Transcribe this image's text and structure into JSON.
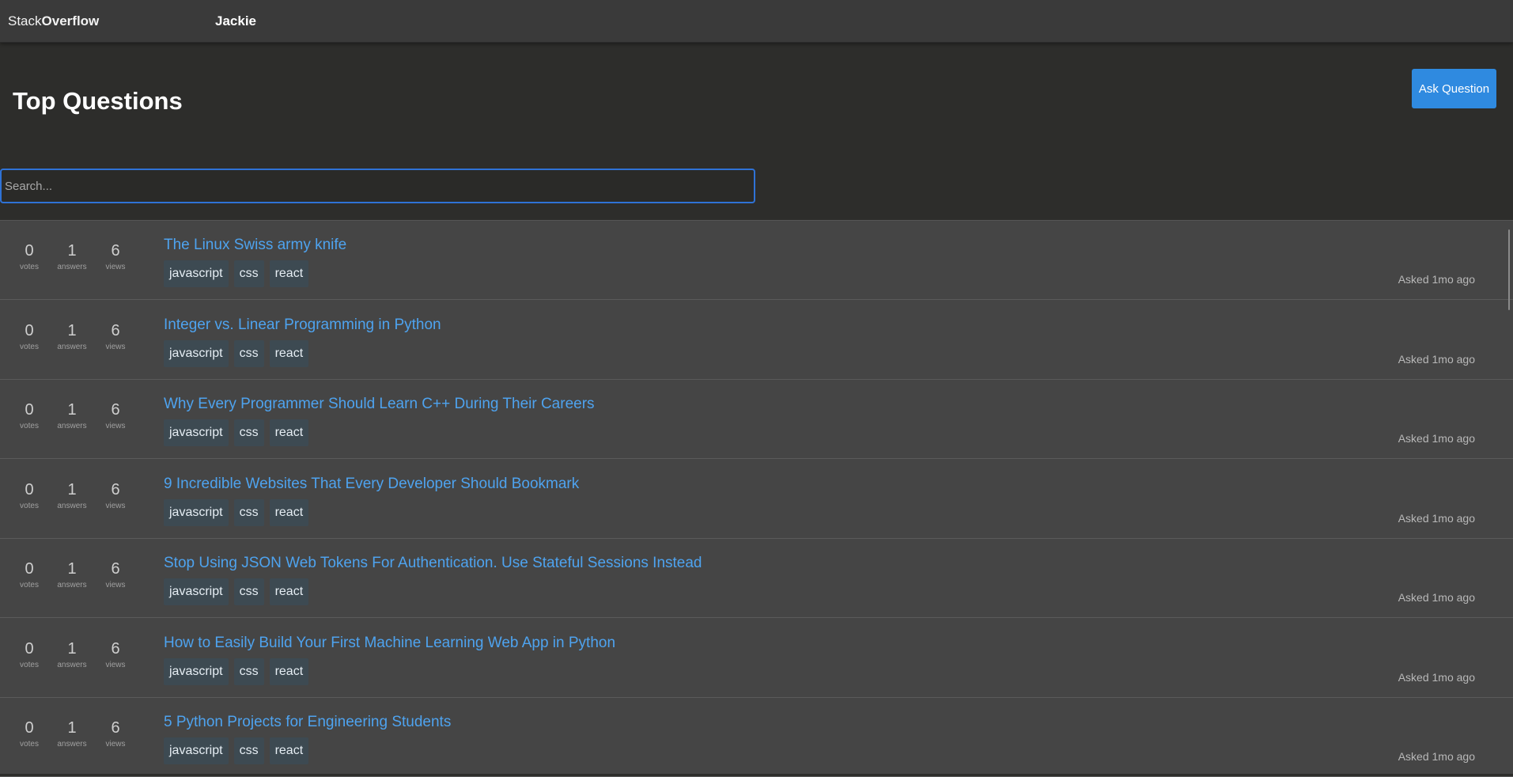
{
  "header": {
    "logo_prefix": "Stack",
    "logo_suffix": "Overflow",
    "user_name": "Jackie"
  },
  "main": {
    "title": "Top Questions",
    "ask_button_label": "Ask Question",
    "search_placeholder": "Search...",
    "stat_labels": {
      "votes": "votes",
      "answers": "answers",
      "views": "views"
    }
  },
  "questions": [
    {
      "title": "The Linux Swiss army knife",
      "votes": "0",
      "answers": "1",
      "views": "6",
      "tags": [
        "javascript",
        "css",
        "react"
      ],
      "asked": "Asked 1mo ago"
    },
    {
      "title": "Integer vs. Linear Programming in Python",
      "votes": "0",
      "answers": "1",
      "views": "6",
      "tags": [
        "javascript",
        "css",
        "react"
      ],
      "asked": "Asked 1mo ago"
    },
    {
      "title": "Why Every Programmer Should Learn C++ During Their Careers",
      "votes": "0",
      "answers": "1",
      "views": "6",
      "tags": [
        "javascript",
        "css",
        "react"
      ],
      "asked": "Asked 1mo ago"
    },
    {
      "title": "9 Incredible Websites That Every Developer Should Bookmark",
      "votes": "0",
      "answers": "1",
      "views": "6",
      "tags": [
        "javascript",
        "css",
        "react"
      ],
      "asked": "Asked 1mo ago"
    },
    {
      "title": "Stop Using JSON Web Tokens For Authentication. Use Stateful Sessions Instead",
      "votes": "0",
      "answers": "1",
      "views": "6",
      "tags": [
        "javascript",
        "css",
        "react"
      ],
      "asked": "Asked 1mo ago"
    },
    {
      "title": "How to Easily Build Your First Machine Learning Web App in Python",
      "votes": "0",
      "answers": "1",
      "views": "6",
      "tags": [
        "javascript",
        "css",
        "react"
      ],
      "asked": "Asked 1mo ago"
    },
    {
      "title": "5 Python Projects for Engineering Students",
      "votes": "0",
      "answers": "1",
      "views": "6",
      "tags": [
        "javascript",
        "css",
        "react"
      ],
      "asked": "Asked 1mo ago"
    }
  ]
}
